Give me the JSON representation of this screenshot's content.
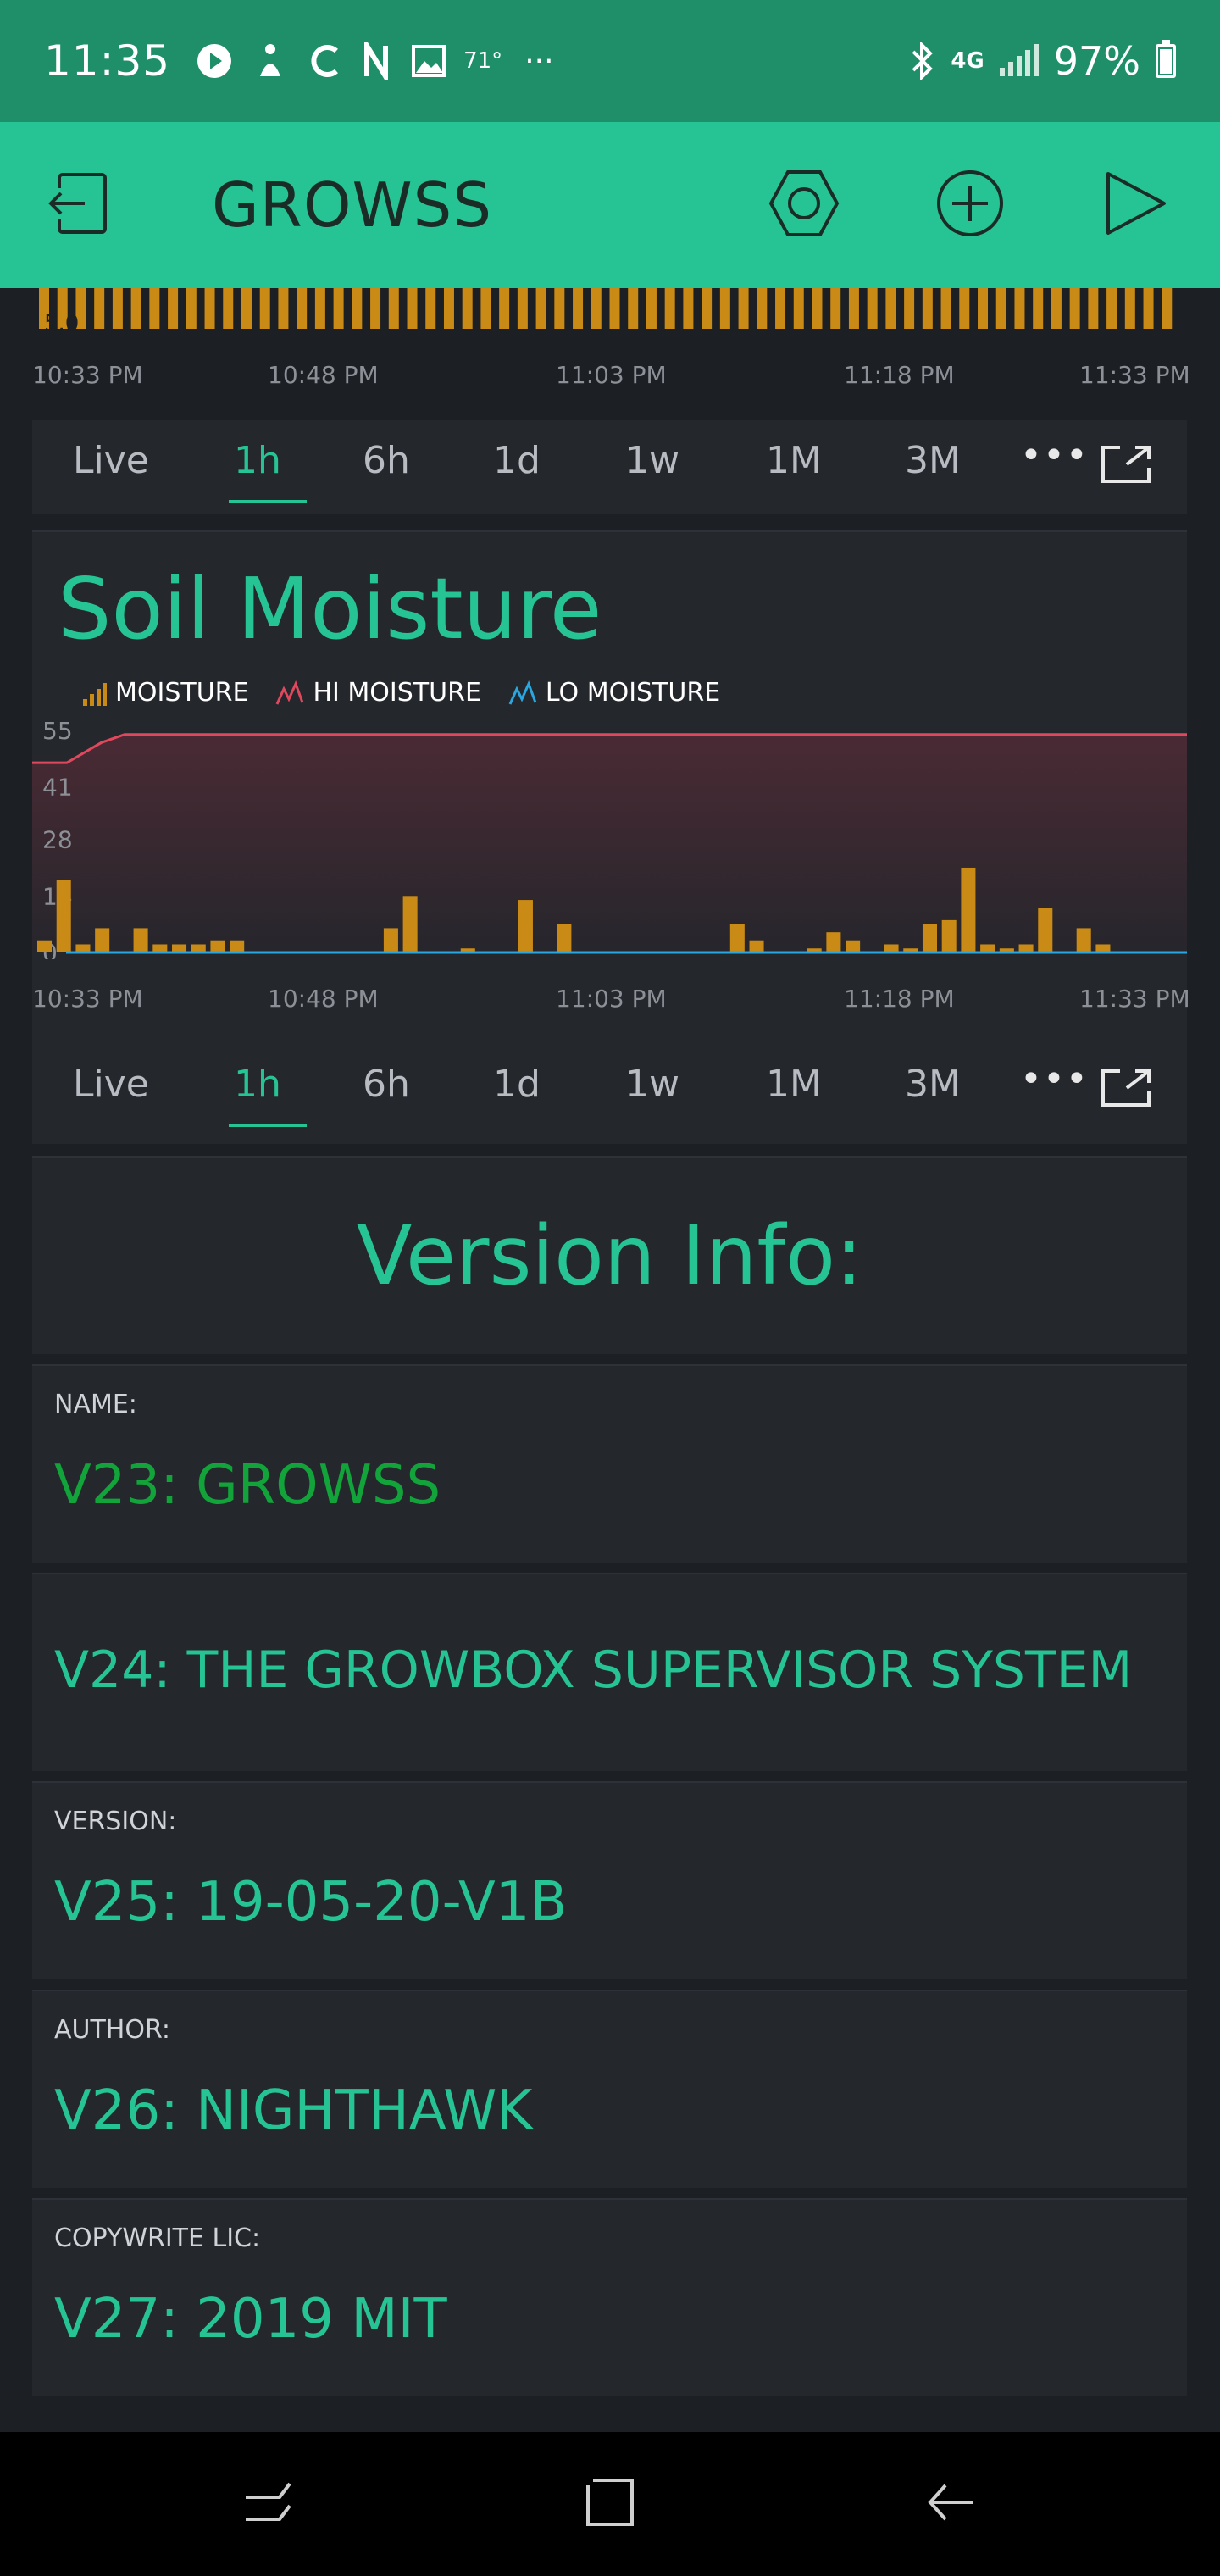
{
  "status_bar": {
    "time": "11:35",
    "temperature": "71°",
    "network": "4G",
    "battery": "97%"
  },
  "app_header": {
    "title": "GROWSS",
    "icons": [
      "exit-icon",
      "hexagon-settings-icon",
      "add-icon",
      "play-icon"
    ]
  },
  "top_chart": {
    "partial_tick": "5.0",
    "x_labels": [
      "10:33 PM",
      "10:48 PM",
      "11:03 PM",
      "11:18 PM",
      "11:33 PM"
    ],
    "bar_color": "#c98a16"
  },
  "range_options": [
    "Live",
    "1h",
    "6h",
    "1d",
    "1w",
    "1M",
    "3M"
  ],
  "selected_range": "1h",
  "soil_chart": {
    "title": "Soil Moisture",
    "legend": [
      "MOISTURE",
      "HI MOISTURE",
      "LO MOISTURE"
    ],
    "colors": {
      "moisture": "#c98a16",
      "hi": "#e0485e",
      "lo": "#2aa7e0",
      "accent": "#26c494"
    }
  },
  "chart_data": {
    "type": "bar",
    "title": "Soil Moisture",
    "y_ticks": [
      "55",
      "41",
      "28",
      "14",
      "0"
    ],
    "ylim": [
      0,
      55
    ],
    "x_labels": [
      "10:33 PM",
      "10:48 PM",
      "11:03 PM",
      "11:18 PM",
      "11:33 PM"
    ],
    "series": [
      {
        "name": "MOISTURE",
        "values": [
          3,
          18,
          2,
          6,
          0,
          6,
          2,
          2,
          2,
          3,
          3,
          0,
          0,
          0,
          0,
          0,
          0,
          0,
          6,
          14,
          0,
          0,
          1,
          0,
          0,
          13,
          0,
          7,
          0,
          0,
          0,
          0,
          0,
          0,
          0,
          0,
          7,
          3,
          0,
          0,
          1,
          5,
          3,
          0,
          2,
          1,
          7,
          8,
          21,
          2,
          1,
          2,
          11,
          0,
          6,
          2,
          0,
          0,
          0,
          0
        ]
      },
      {
        "name": "HI MOISTURE",
        "x_fraction": [
          0,
          0.03,
          0.06,
          0.08,
          1
        ],
        "values": [
          47,
          47,
          52,
          54,
          54
        ]
      },
      {
        "name": "LO MOISTURE",
        "values": [
          0,
          0
        ]
      }
    ]
  },
  "version_info": {
    "heading": "Version Info:",
    "fields": [
      {
        "label": "NAME:",
        "value": "V23: GROWSS"
      },
      {
        "label": "",
        "value": "V24: THE GROWBOX SUPERVISOR SYSTEM"
      },
      {
        "label": "VERSION:",
        "value": "V25: 19-05-20-V1B"
      },
      {
        "label": "AUTHOR:",
        "value": "V26: NIGHTHAWK"
      },
      {
        "label": "COPYWRITE LIC:",
        "value": "V27: 2019 MIT"
      }
    ]
  },
  "nav_bar": {
    "icons": [
      "recents-icon",
      "home-icon",
      "back-icon"
    ]
  }
}
